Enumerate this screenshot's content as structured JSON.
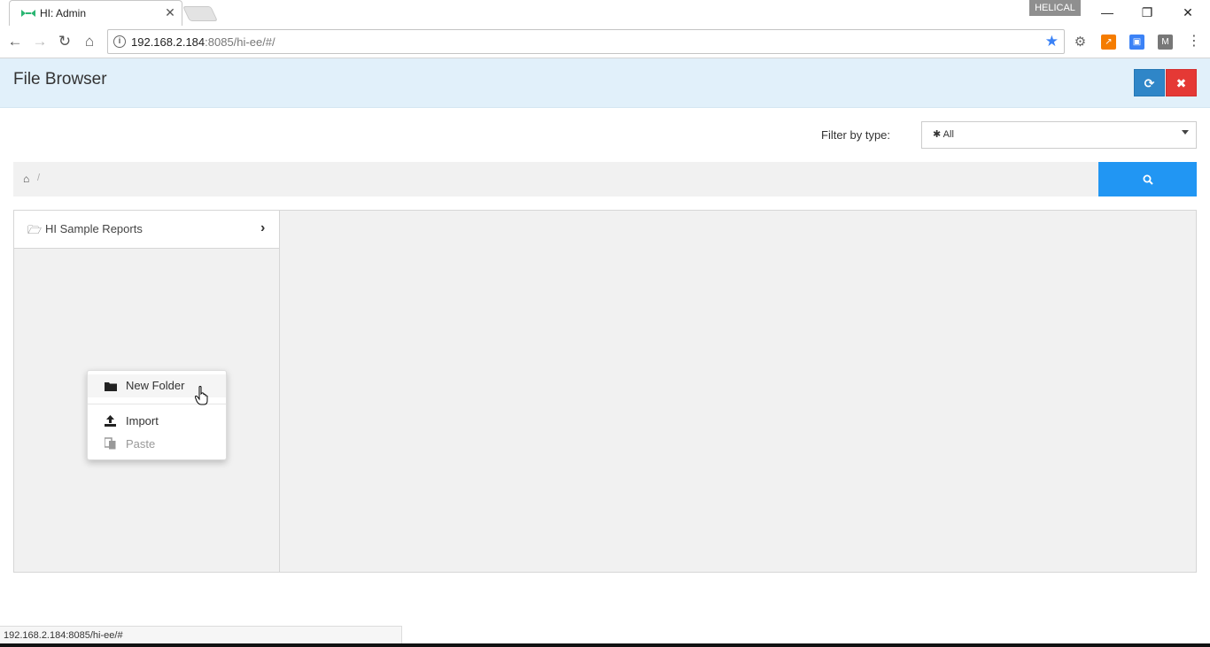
{
  "browser": {
    "tab_title": "HI: Admin",
    "tab_close": "✕",
    "profile_badge": "HELICAL",
    "window_controls": {
      "minimize": "—",
      "maximize": "❐",
      "close": "✕"
    },
    "url_host": "192.168.2.184",
    "url_rest": ":8085/hi-ee/#/",
    "status_url": "192.168.2.184:8085/hi-ee/#",
    "star_color": "#3b82f6",
    "icons": {
      "back": "arrow-left-icon",
      "forward": "arrow-right-icon",
      "reload": "reload-icon",
      "home": "home-icon",
      "info": "info-icon",
      "bookmark": "star-icon",
      "menu": "kebab-menu-icon"
    }
  },
  "app": {
    "title": "File Browser",
    "colors": {
      "header_bg": "#e1f0fa",
      "refresh": "#2f86c8",
      "close": "#e53935",
      "search": "#2196f3"
    },
    "filter": {
      "label": "Filter by type:",
      "value": "All",
      "icon": "asterisk-icon"
    },
    "breadcrumb": {
      "home_icon": "home-icon",
      "separator": "/"
    },
    "search_icon": "search-icon",
    "folders": [
      {
        "label": "HI Sample Reports",
        "icon": "folder-open-icon"
      }
    ],
    "context_menu": {
      "items": [
        {
          "label": "New Folder",
          "icon": "folder-icon",
          "enabled": true
        },
        {
          "label": "Import",
          "icon": "upload-icon",
          "enabled": true
        },
        {
          "label": "Paste",
          "icon": "paste-icon",
          "enabled": false
        }
      ]
    }
  }
}
